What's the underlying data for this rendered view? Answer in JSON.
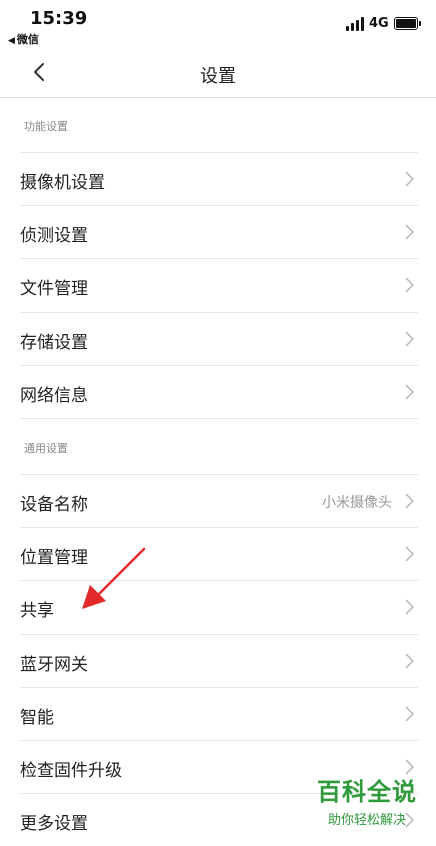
{
  "status_bar": {
    "time": "15:39",
    "back_app": "微信",
    "network": "4G"
  },
  "nav": {
    "title": "设置"
  },
  "sections": [
    {
      "header": "功能设置",
      "items": [
        {
          "label": "摄像机设置"
        },
        {
          "label": "侦测设置"
        },
        {
          "label": "文件管理"
        },
        {
          "label": "存储设置"
        },
        {
          "label": "网络信息"
        }
      ]
    },
    {
      "header": "通用设置",
      "items": [
        {
          "label": "设备名称",
          "value": "小米摄像头"
        },
        {
          "label": "位置管理"
        },
        {
          "label": "共享"
        },
        {
          "label": "蓝牙网关"
        },
        {
          "label": "智能"
        },
        {
          "label": "检查固件升级"
        },
        {
          "label": "更多设置"
        }
      ]
    }
  ],
  "annotation": {
    "arrow_color": "#e32a2a",
    "icon": "red-arrow-icon"
  },
  "watermark": {
    "title": "百科全说",
    "subtitle": "助你轻松解决",
    "color": "#2e9a3a"
  }
}
